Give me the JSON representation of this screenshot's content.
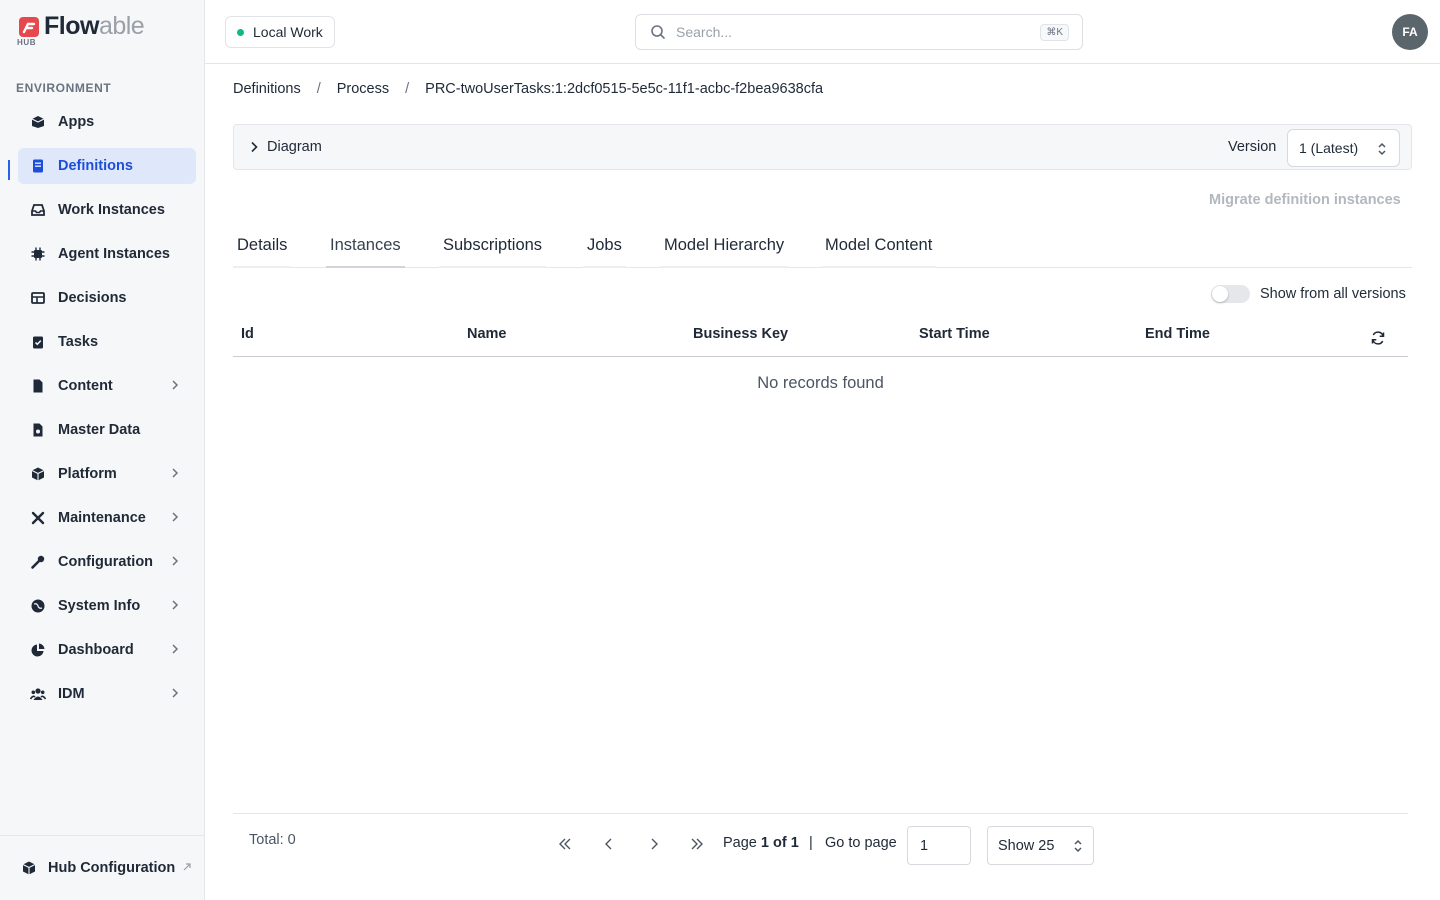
{
  "brand": {
    "name_main": "Flow",
    "name_light": "able",
    "sub": "HUB",
    "mark_color": "#e5484d"
  },
  "sidebar": {
    "section_label": "ENVIRONMENT",
    "items": [
      {
        "label": "Apps",
        "icon": "box-open-icon",
        "chevron": false,
        "active": false
      },
      {
        "label": "Definitions",
        "icon": "book-icon",
        "chevron": false,
        "active": true
      },
      {
        "label": "Work Instances",
        "icon": "inbox-icon",
        "chevron": false,
        "active": false
      },
      {
        "label": "Agent Instances",
        "icon": "chip-icon",
        "chevron": false,
        "active": false
      },
      {
        "label": "Decisions",
        "icon": "table-icon",
        "chevron": false,
        "active": false
      },
      {
        "label": "Tasks",
        "icon": "clipboard-check-icon",
        "chevron": false,
        "active": false
      },
      {
        "label": "Content",
        "icon": "file-icon",
        "chevron": true,
        "active": false
      },
      {
        "label": "Master Data",
        "icon": "file-data-icon",
        "chevron": false,
        "active": false
      },
      {
        "label": "Platform",
        "icon": "cube-icon",
        "chevron": true,
        "active": false
      },
      {
        "label": "Maintenance",
        "icon": "tools-icon",
        "chevron": true,
        "active": false
      },
      {
        "label": "Configuration",
        "icon": "wrench-icon",
        "chevron": true,
        "active": false
      },
      {
        "label": "System Info",
        "icon": "globe-icon",
        "chevron": true,
        "active": false
      },
      {
        "label": "Dashboard",
        "icon": "pie-chart-icon",
        "chevron": true,
        "active": false
      },
      {
        "label": "IDM",
        "icon": "users-icon",
        "chevron": true,
        "active": false
      }
    ],
    "footer_label": "Hub Configuration"
  },
  "topbar": {
    "workspace_label": "Local Work",
    "search_placeholder": "Search...",
    "search_shortcut": "⌘K",
    "avatar_initials": "FA"
  },
  "breadcrumb": {
    "items": [
      "Definitions",
      "Process",
      "PRC-twoUserTasks:1:2dcf0515-5e5c-11f1-acbc-f2bea9638cfa"
    ],
    "separator": "/"
  },
  "diagram": {
    "label": "Diagram",
    "version_label": "Version",
    "version_value": "1 (Latest)"
  },
  "migrate_label": "Migrate definition instances",
  "tabs": [
    {
      "label": "Details",
      "active": false
    },
    {
      "label": "Instances",
      "active": true
    },
    {
      "label": "Subscriptions",
      "active": false
    },
    {
      "label": "Jobs",
      "active": false
    },
    {
      "label": "Model Hierarchy",
      "active": false
    },
    {
      "label": "Model Content",
      "active": false
    }
  ],
  "show_all_versions": {
    "label": "Show from all versions",
    "checked": false
  },
  "table": {
    "columns": [
      "Id",
      "Name",
      "Business Key",
      "Start Time",
      "End Time"
    ],
    "rows": [],
    "empty_message": "No records found"
  },
  "pagination": {
    "total_label": "Total: 0",
    "page_prefix": "Page",
    "page_current": "1 of 1",
    "separator": "|",
    "goto_label": "Go to page",
    "goto_value": "1",
    "show_value": "Show 25"
  },
  "colors": {
    "accent": "#2563eb",
    "active_bg": "#dfe8fb",
    "status_dot": "#10b981",
    "avatar_bg": "#5b666c"
  }
}
